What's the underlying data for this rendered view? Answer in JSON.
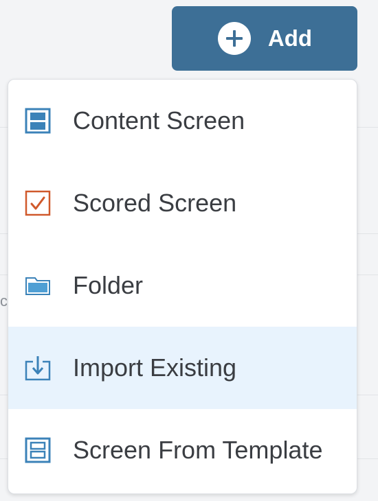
{
  "toolbar": {
    "add_label": "Add",
    "add_icon": "plus-circle-icon",
    "button_color": "#3d6f96"
  },
  "menu": {
    "hover_color": "#e8f3fd",
    "items": [
      {
        "label": "Content Screen",
        "icon": "content-screen-icon",
        "icon_color": "#3b82b8",
        "hovered": false
      },
      {
        "label": "Scored Screen",
        "icon": "scored-screen-icon",
        "icon_color": "#d0592b",
        "hovered": false
      },
      {
        "label": "Folder",
        "icon": "folder-icon",
        "icon_color": "#4f9fd4",
        "hovered": false
      },
      {
        "label": "Import Existing",
        "icon": "import-icon",
        "icon_color": "#3b82b8",
        "hovered": true
      },
      {
        "label": "Screen From Template",
        "icon": "template-screen-icon",
        "icon_color": "#3b82b8",
        "hovered": false
      }
    ]
  }
}
